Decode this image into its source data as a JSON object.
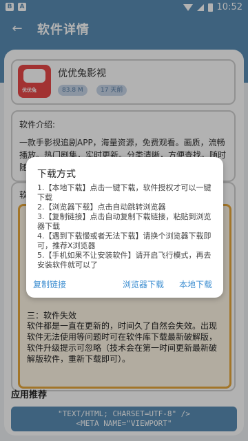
{
  "status_bar": {
    "left_icons": [
      "B",
      "A"
    ],
    "time": "10:52"
  },
  "app_bar": {
    "back_icon": "←",
    "title": "软件详情"
  },
  "app": {
    "name": "优优兔影视",
    "logo_text": "优优兔",
    "size": "83.8 M",
    "updated": "17 天前"
  },
  "intro": {
    "title": "软件介绍:",
    "body": "一款手影视追剧APP，海量资源，免费观看。画质，流畅播放。热门剧集，实时更新。分类清晰，方便查找。随时随地，轻松观看。"
  },
  "install": {
    "title_visible": "软",
    "fail_title": "三：软件失效",
    "fail_body": "软件都是一直在更新的，时间久了自然会失效。出现软件无法使用等问题时可在软件库下载最新破解版，软件升级提示可忽略（技术会在第一时间更新最新破解版软件，重新下载即可）。"
  },
  "recommend_title": "应用推荐",
  "bottom_button": {
    "line1": "\"TEXT/HTML; CHARSET=UTF-8\" />",
    "line2": "<META NAME=\"VIEWPORT\""
  },
  "dialog": {
    "title": "下载方式",
    "items": [
      "1.【本地下载】点击一键下载，软件授权才可以一键下载",
      "2.【浏览器下载】点击自动跳转浏览器",
      "3.【复制链接】点击自动复制下载链接，粘贴到浏览器下载",
      "4.【遇到下载慢或者无法下载】请换个浏览器下载即可，推荐X浏览器",
      "5.【手机如果不让安装软件】请开启飞行模式，再去安装软件就可以了"
    ],
    "buttons": {
      "copy": "复制链接",
      "browser": "浏览器下载",
      "local": "本地下载"
    }
  },
  "colors": {
    "primary": "#5a8db5",
    "accent_link": "#3f8fd1",
    "panel_border": "#e8a83c",
    "logo_red": "#e94848"
  }
}
